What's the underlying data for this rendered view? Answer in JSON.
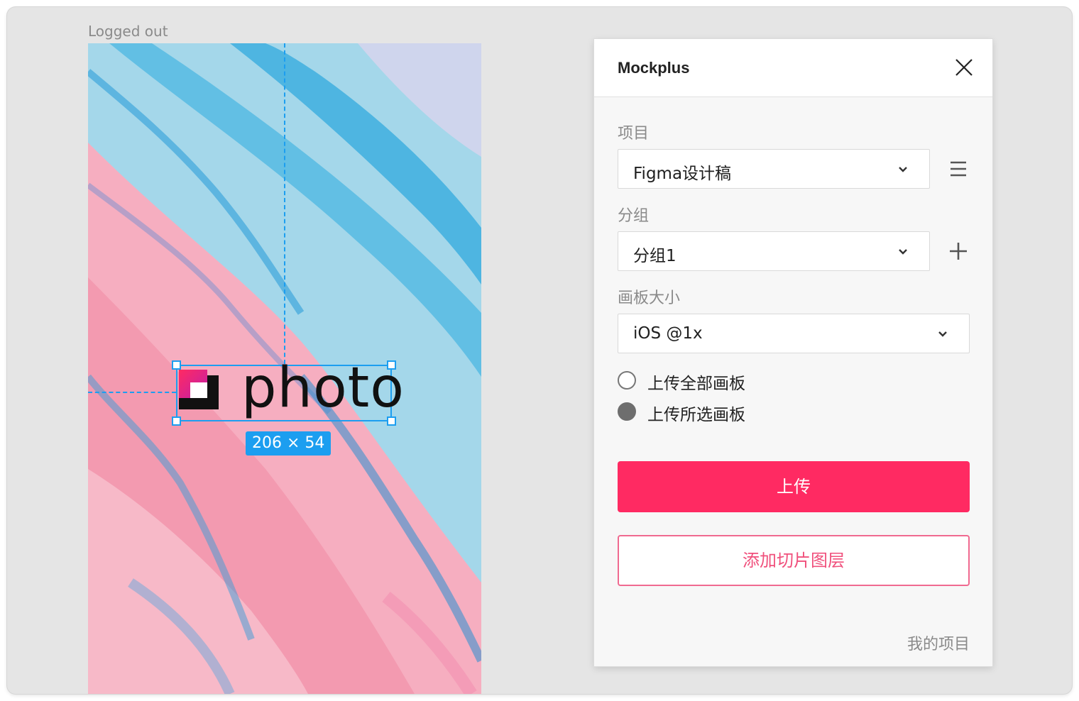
{
  "canvas": {
    "frame_label": "Logged out",
    "logo_text": "photo",
    "size_badge": "206 × 54"
  },
  "panel": {
    "title": "Mockplus",
    "project": {
      "label": "项目",
      "value": "Figma设计稿"
    },
    "group": {
      "label": "分组",
      "value": "分组1"
    },
    "artboard_size": {
      "label": "画板大小",
      "value": "iOS @1x"
    },
    "upload_options": [
      {
        "label": "上传全部画板",
        "checked": false
      },
      {
        "label": "上传所选画板",
        "checked": true
      }
    ],
    "upload_button": "上传",
    "add_slice_button": "添加切片图层",
    "footer_link": "我的项目"
  },
  "colors": {
    "accent": "#ff2a62",
    "selection": "#1c9ef0"
  }
}
